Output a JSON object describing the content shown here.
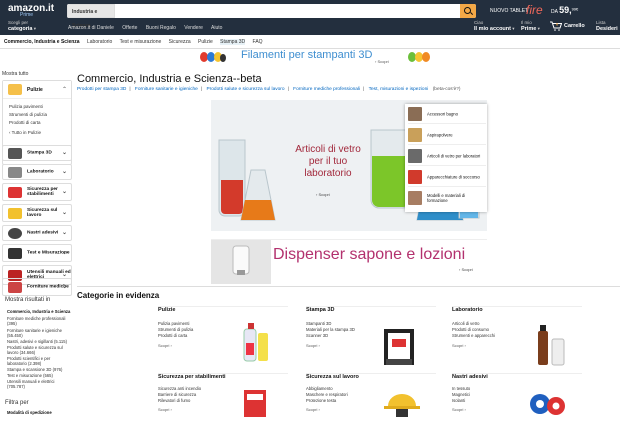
{
  "header": {
    "logo": "amazon.it",
    "logo_sub": "Prime",
    "search_category": "Industria e Scienza",
    "search_placeholder": "",
    "promo": "NUOVO TABLET",
    "fire_brand": "fire",
    "price_da": "DA",
    "price_main": "59,",
    "price_cents": "99€",
    "deliver_top": "Scegli per",
    "deliver_bottom": "categoria",
    "nav": [
      "Amazon.it di Daniele",
      "Offerte",
      "Buoni Regalo",
      "Vendere",
      "Aiuto"
    ],
    "account": {
      "top": "Ciao",
      "bottom": "Il mio account"
    },
    "prime": {
      "top": "Il mio",
      "bottom": "Prime"
    },
    "cart": {
      "count": "0",
      "label": "Carrello"
    },
    "wishlist": {
      "top": "Lista",
      "bottom": "Desideri"
    }
  },
  "subnav": [
    "Commercio, Industria e Scienza",
    "Laboratorio",
    "Test e misurazione",
    "Sicurezza",
    "Pulizie",
    "Stampa 3D",
    "FAQ"
  ],
  "banner_3d": {
    "text": "Filamenti per stampanti 3D",
    "link": "› Scopri"
  },
  "sidebar": {
    "top": "Mostra tutto",
    "selected": {
      "label": "Pulizie",
      "items": [
        "Pulizia pavimenti",
        "Strumenti di pulizia",
        "Prodotti di carta",
        "‹ Tutto in Pulizie"
      ]
    },
    "categories": [
      {
        "label": "Stampa 3D"
      },
      {
        "label": "Laboratorio"
      },
      {
        "label": "Sicurezza per stabilimenti"
      },
      {
        "label": "Sicurezza sul lavoro"
      },
      {
        "label": "Nastri adesivi"
      },
      {
        "label": "Test e Misurazione"
      },
      {
        "label": "Utensili manuali ed elettrici"
      },
      {
        "label": "Forniture mediche"
      }
    ],
    "results_title": "Mostra risultati in",
    "results": [
      "Commercio, Industria e Scienza",
      "Forniture mediche professionali (395)",
      "Forniture sanitarie e igieniche (55.450)",
      "Nastri, adesivi e sigillanti (5.115)",
      "Prodotti salute e sicurezza sul lavoro (34.666)",
      "Prodotti scientifici e per laboratorio (2.398)",
      "Stampa e scansione 3D (976)",
      "Test e misurazione (565)",
      "Utensili manuali e elettrici (705.787)"
    ],
    "filter_title": "Filtra per",
    "filter_sub": "Modalità di spedizione"
  },
  "main": {
    "title": "Commercio, Industria e Scienza--beta",
    "crumbs": [
      "Prodotti per stampa 3D",
      "Forniture sanitarie e igieniche",
      "Prodotti salute e sicurezza sul lavoro",
      "Forniture mediche professionali",
      "Test, misurazioni e ispezioni"
    ],
    "crumbs_tail": "(beta-cos'è?)",
    "hero": {
      "text": "Articoli di vetro per il tuo laboratorio",
      "link": "› Scopri"
    },
    "flyout": [
      "Accessori bagno",
      "Aspirapolvere",
      "Articoli di vetro per laboratori",
      "Apparecchiature di soccorso",
      "Modelli e materiali di formazione"
    ],
    "banner2": {
      "text": "Dispenser sapone e lozioni",
      "link": "› Scopri"
    },
    "featured_title": "Categorie in evidenza",
    "cards": [
      {
        "name": "Pulizie",
        "items": [
          "Pulizia pavimenti",
          "Strumenti di pulizia",
          "Prodotti di carta"
        ],
        "more": "Scopri ›"
      },
      {
        "name": "Stampa 3D",
        "items": [
          "Stampanti 3D",
          "Materiali per la stampa 3D",
          "Scanner 3D"
        ],
        "more": "Scopri ›"
      },
      {
        "name": "Laboratorio",
        "items": [
          "Articoli di vetro",
          "Prodotti di consumo",
          "Strumenti e apparecchi"
        ],
        "more": "Scopri ›"
      },
      {
        "name": "Sicurezza per stabilimenti",
        "items": [
          "Sicurezza anti incendio",
          "Barriere di sicurezza",
          "Rilevatori di fumo"
        ],
        "more": "Scopri ›"
      },
      {
        "name": "Sicurezza sul lavoro",
        "items": [
          "Abbigliamento",
          "Maschere e respiratori",
          "Protezione testa"
        ],
        "more": "Scopri ›"
      },
      {
        "name": "Nastri adesivi",
        "items": [
          "In tessuto",
          "Magnetici",
          "Isolanti"
        ],
        "more": "Scopri ›"
      }
    ]
  }
}
